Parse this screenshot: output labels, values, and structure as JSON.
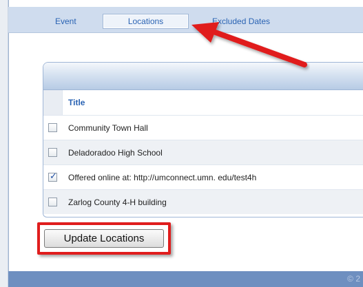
{
  "tabs": [
    {
      "label": "Event",
      "active": false
    },
    {
      "label": "Locations",
      "active": true
    },
    {
      "label": "Excluded Dates",
      "active": false
    }
  ],
  "table": {
    "column_header": "Title",
    "rows": [
      {
        "label": "Community Town Hall",
        "checked": false
      },
      {
        "label": "Deladoradoo High School",
        "checked": false
      },
      {
        "label": "Offered online at: http://umconnect.umn. edu/test4h",
        "checked": true
      },
      {
        "label": "Zarlog County 4-H building",
        "checked": false
      }
    ]
  },
  "update_button": {
    "label": "Update Locations"
  },
  "footer": {
    "text": "© 2"
  },
  "annotations": {
    "arrow_color": "#e01d1d",
    "highlight_color": "#e01d1d"
  },
  "colors": {
    "tab_bar": "#cfdcee",
    "link": "#2a63b3",
    "footer": "#6e8fc0"
  }
}
